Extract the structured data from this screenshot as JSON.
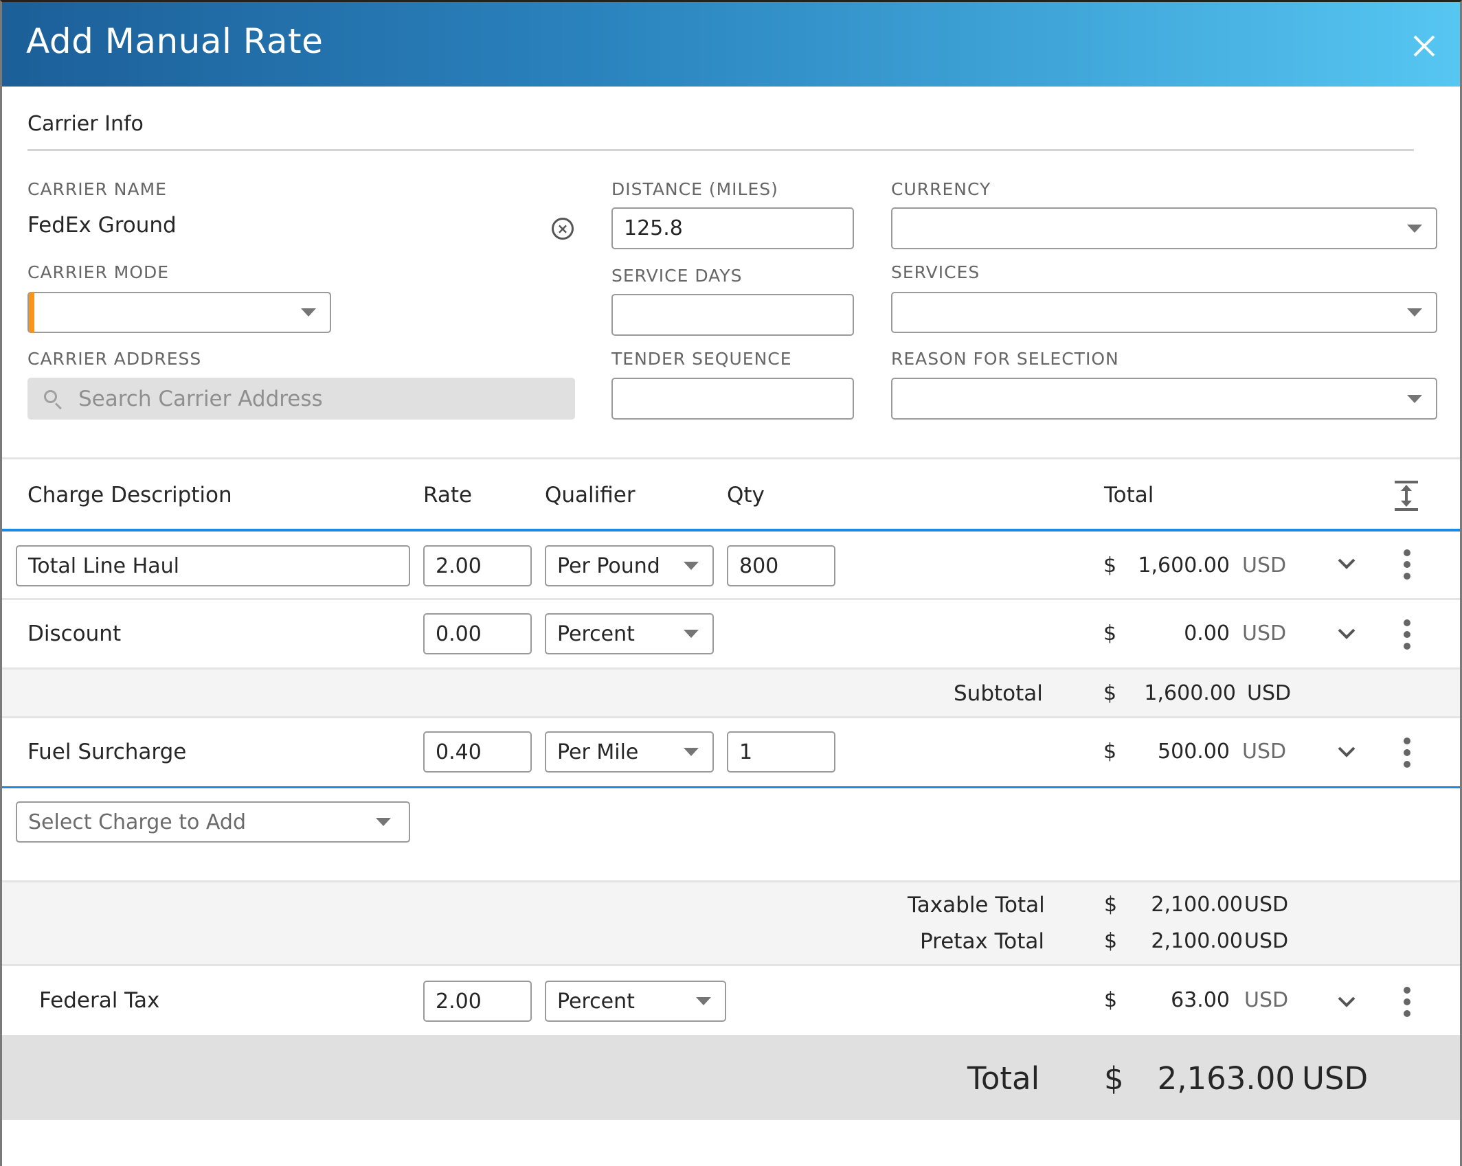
{
  "dialog": {
    "title": "Add Manual Rate",
    "close_icon": "close-icon"
  },
  "carrier_info": {
    "section_title": "Carrier Info",
    "carrier_name": {
      "label": "CARRIER NAME",
      "value": "FedEx Ground",
      "clear_icon": "clear-circle-icon"
    },
    "carrier_mode": {
      "label": "CARRIER MODE",
      "value": ""
    },
    "carrier_address": {
      "label": "CARRIER ADDRESS",
      "placeholder": "Search Carrier Address",
      "icon": "search-icon"
    },
    "distance": {
      "label": "DISTANCE (MILES)",
      "value": "125.8"
    },
    "service_days": {
      "label": "SERVICE DAYS",
      "value": ""
    },
    "tender_sequence": {
      "label": "TENDER SEQUENCE",
      "value": ""
    },
    "currency": {
      "label": "CURRENCY",
      "value": ""
    },
    "services": {
      "label": "SERVICES",
      "value": ""
    },
    "reason_for_selection": {
      "label": "REASON FOR SELECTION",
      "value": ""
    },
    "required_accent_color": "#f7941d"
  },
  "charges": {
    "columns": {
      "description": "Charge Description",
      "rate": "Rate",
      "qualifier": "Qualifier",
      "qty": "Qty",
      "total": "Total"
    },
    "rows": [
      {
        "description": "Total Line Haul",
        "rate": "2.00",
        "qualifier": "Per Pound",
        "qty": "800",
        "currency_symbol": "$",
        "amount": "1,600.00",
        "currency": "USD"
      },
      {
        "description": "Discount",
        "rate": "0.00",
        "qualifier": "Percent",
        "qty": "",
        "currency_symbol": "$",
        "amount": "0.00",
        "currency": "USD"
      },
      {
        "description": "Fuel Surcharge",
        "rate": "0.40",
        "qualifier": "Per Mile",
        "qty": "1",
        "currency_symbol": "$",
        "amount": "500.00",
        "currency": "USD"
      }
    ],
    "subtotal": {
      "label": "Subtotal",
      "currency_symbol": "$",
      "amount": "1,600.00",
      "currency": "USD"
    },
    "add_charge": {
      "placeholder": "Select Charge to Add"
    },
    "taxable_total": {
      "label": "Taxable Total",
      "currency_symbol": "$",
      "amount": "2,100.00",
      "currency": "USD"
    },
    "pretax_total": {
      "label": "Pretax Total",
      "currency_symbol": "$",
      "amount": "2,100.00",
      "currency": "USD"
    },
    "tax_rows": [
      {
        "description": "Federal Tax",
        "rate": "2.00",
        "qualifier": "Percent",
        "currency_symbol": "$",
        "amount": "63.00",
        "currency": "USD"
      }
    ],
    "grand_total": {
      "label": "Total",
      "currency_symbol": "$",
      "amount": "2,163.00",
      "currency": "USD"
    },
    "accent_color": "#1e88e5"
  }
}
